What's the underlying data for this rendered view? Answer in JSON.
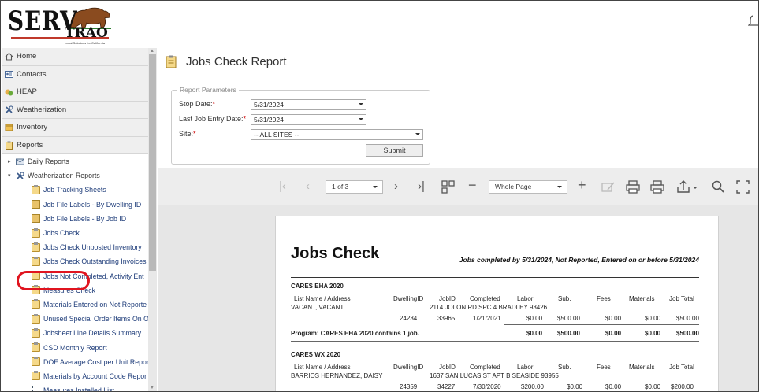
{
  "logo": {
    "name": "SERV",
    "sub": "TRAQ",
    "tagline": "Local Solutions for California"
  },
  "sidebar": {
    "menu": [
      {
        "label": "Home",
        "icon": "home-icon"
      },
      {
        "label": "Contacts",
        "icon": "address-card-icon"
      },
      {
        "label": "HEAP",
        "icon": "money-bag-icon"
      },
      {
        "label": "Weatherization",
        "icon": "tools-icon"
      },
      {
        "label": "Inventory",
        "icon": "box-icon"
      },
      {
        "label": "Reports",
        "icon": "clipboard-icon"
      }
    ],
    "tree": {
      "daily": "Daily Reports",
      "weatherization": "Weatherization Reports",
      "items": [
        "Job Tracking Sheets",
        "Job File Labels - By Dwelling ID",
        "Job File Labels - By Job ID",
        "Jobs Check",
        "Jobs Check Unposted Inventory",
        "Jobs Check Outstanding Invoices",
        "Jobs Not Completed, Activity Ent",
        "Measures Check",
        "Materials Entered on Not Reporte",
        "Unused Special Order Items On O",
        "Jobsheet Line Details Summary",
        "CSD Monthly Report",
        "DOE Average Cost per Unit Repor",
        "Materials by Account Code Repor",
        "Measures Installed List"
      ]
    }
  },
  "main": {
    "title": "Jobs Check Report",
    "params": {
      "legend": "Report Parameters",
      "stop_date_label": "Stop Date:",
      "stop_date_value": "5/31/2024",
      "last_entry_label": "Last Job Entry Date:",
      "last_entry_value": "5/31/2024",
      "site_label": "Site:",
      "site_value": "-- ALL SITES --",
      "required_mark": "*",
      "submit": "Submit"
    },
    "toolbar": {
      "page": "1 of 3",
      "zoom": "Whole Page"
    }
  },
  "report": {
    "title": "Jobs Check",
    "subtitle": "Jobs completed by 5/31/2024, Not Reported, Entered on or before 5/31/2024",
    "headers": [
      "List Name / Address",
      "DwellingID",
      "JobID",
      "Completed",
      "Labor",
      "Sub.",
      "Fees",
      "Materials",
      "Job Total"
    ],
    "programs": [
      {
        "name": "CARES EHA 2020",
        "client": "VACANT, VACANT",
        "address": "2114 JOLON RD SPC 4 BRADLEY 93426",
        "row": [
          "24234",
          "33965",
          "1/21/2021",
          "$0.00",
          "$500.00",
          "$0.00",
          "$0.00",
          "$500.00"
        ],
        "summary": "Program: CARES EHA 2020 contains 1 job.",
        "totals": [
          "$0.00",
          "$500.00",
          "$0.00",
          "$0.00",
          "$500.00"
        ]
      },
      {
        "name": "CARES WX 2020",
        "client": "BARRIOS HERNANDEZ, DAISY",
        "address": "1637 SAN LUCAS ST APT B SEASIDE 93955",
        "row": [
          "24359",
          "34227",
          "7/30/2020",
          "$200.00",
          "$0.00",
          "$0.00",
          "$0.00",
          "$200.00"
        ]
      }
    ]
  }
}
